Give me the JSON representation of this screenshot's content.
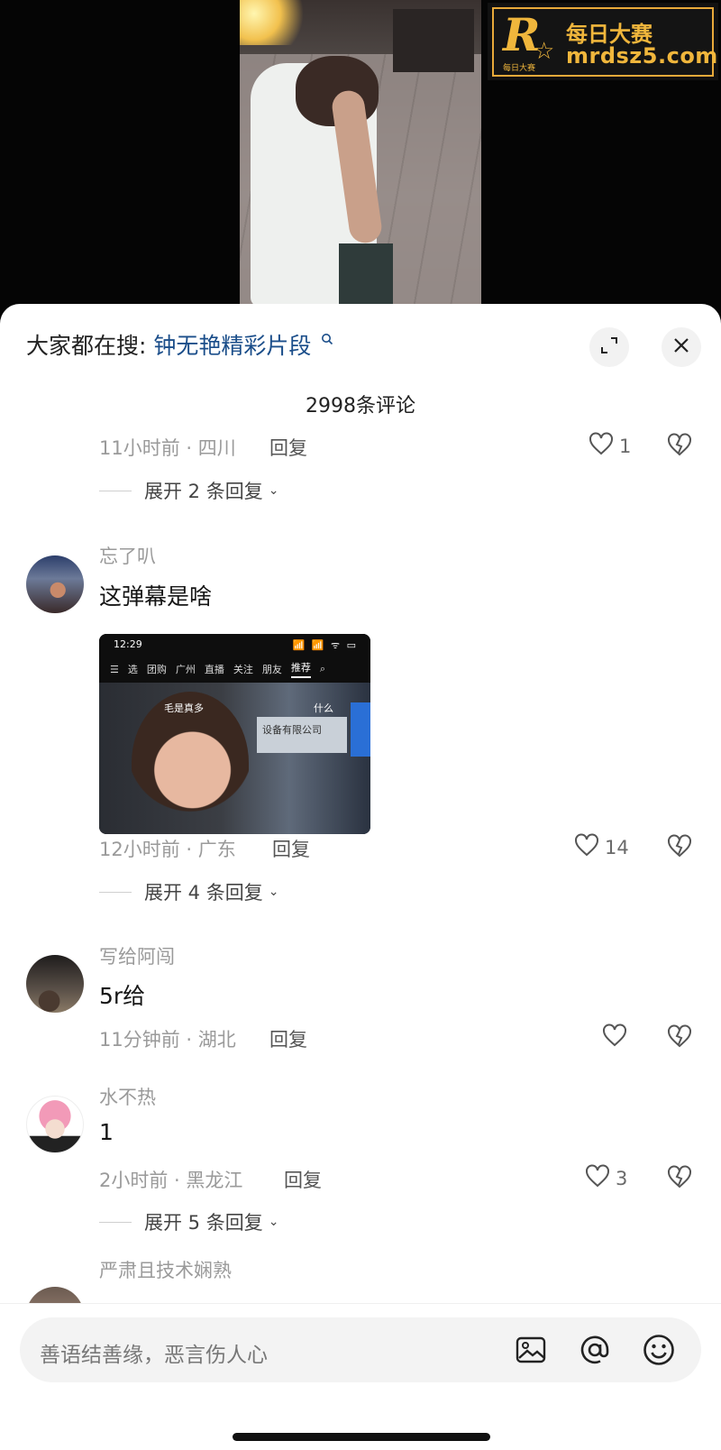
{
  "watermark": {
    "brand_letter": "R",
    "brand_sub": "每日大赛",
    "name": "每日大赛",
    "url": "mrdsz5.com"
  },
  "header": {
    "search_prefix": "大家都在搜:",
    "search_keyword": "钟无艳精彩片段",
    "comment_count": "2998条评论"
  },
  "comments": [
    {
      "meta": "11小时前 · 四川",
      "reply_label": "回复",
      "likes": "1",
      "expand_label": "展开 2 条回复"
    },
    {
      "username": "忘了叭",
      "text": "这弹幕是啥",
      "meta": "12小时前 · 广东",
      "reply_label": "回复",
      "likes": "14",
      "expand_label": "展开 4 条回复",
      "image": {
        "time": "12:29",
        "status_icons": "📶 📶 ᯤ ▭",
        "tabs": [
          "选",
          "团购",
          "广州",
          "直播",
          "关注",
          "朋友",
          "推荐"
        ],
        "danmaku_1": "毛是真多",
        "danmaku_2": "什么",
        "sign_text": "设备有限公司"
      }
    },
    {
      "username": "写给阿闯",
      "text": "5r给",
      "meta": "11分钟前 · 湖北",
      "reply_label": "回复",
      "likes": ""
    },
    {
      "username": "水不热",
      "text": "1",
      "meta": "2小时前 · 黑龙江",
      "reply_label": "回复",
      "likes": "3",
      "expand_label": "展开 5 条回复"
    },
    {
      "username": "严肃且技术娴熟"
    }
  ],
  "input": {
    "placeholder": "善语结善缘，恶言伤人心"
  },
  "icons": {
    "expand": "expand-icon",
    "close": "close-icon",
    "like": "heart-icon",
    "dislike": "broken-heart-icon",
    "image": "image-icon",
    "mention": "at-icon",
    "emoji": "emoji-icon"
  }
}
